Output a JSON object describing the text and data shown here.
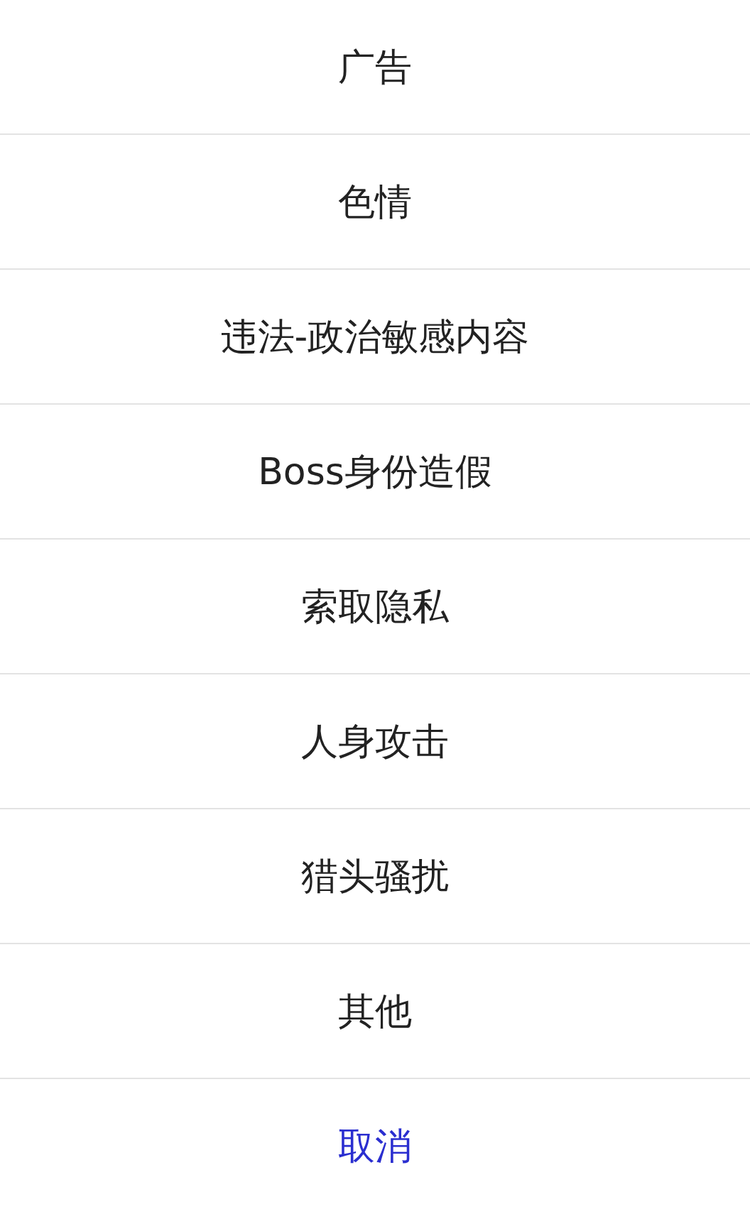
{
  "actions": [
    {
      "label": "广告",
      "kind": "option"
    },
    {
      "label": "色情",
      "kind": "option"
    },
    {
      "label": "违法-政治敏感内容",
      "kind": "option"
    },
    {
      "label": "Boss身份造假",
      "kind": "option"
    },
    {
      "label": "索取隐私",
      "kind": "option"
    },
    {
      "label": "人身攻击",
      "kind": "option"
    },
    {
      "label": "猎头骚扰",
      "kind": "option"
    },
    {
      "label": "其他",
      "kind": "option"
    },
    {
      "label": "取消",
      "kind": "cancel"
    }
  ]
}
